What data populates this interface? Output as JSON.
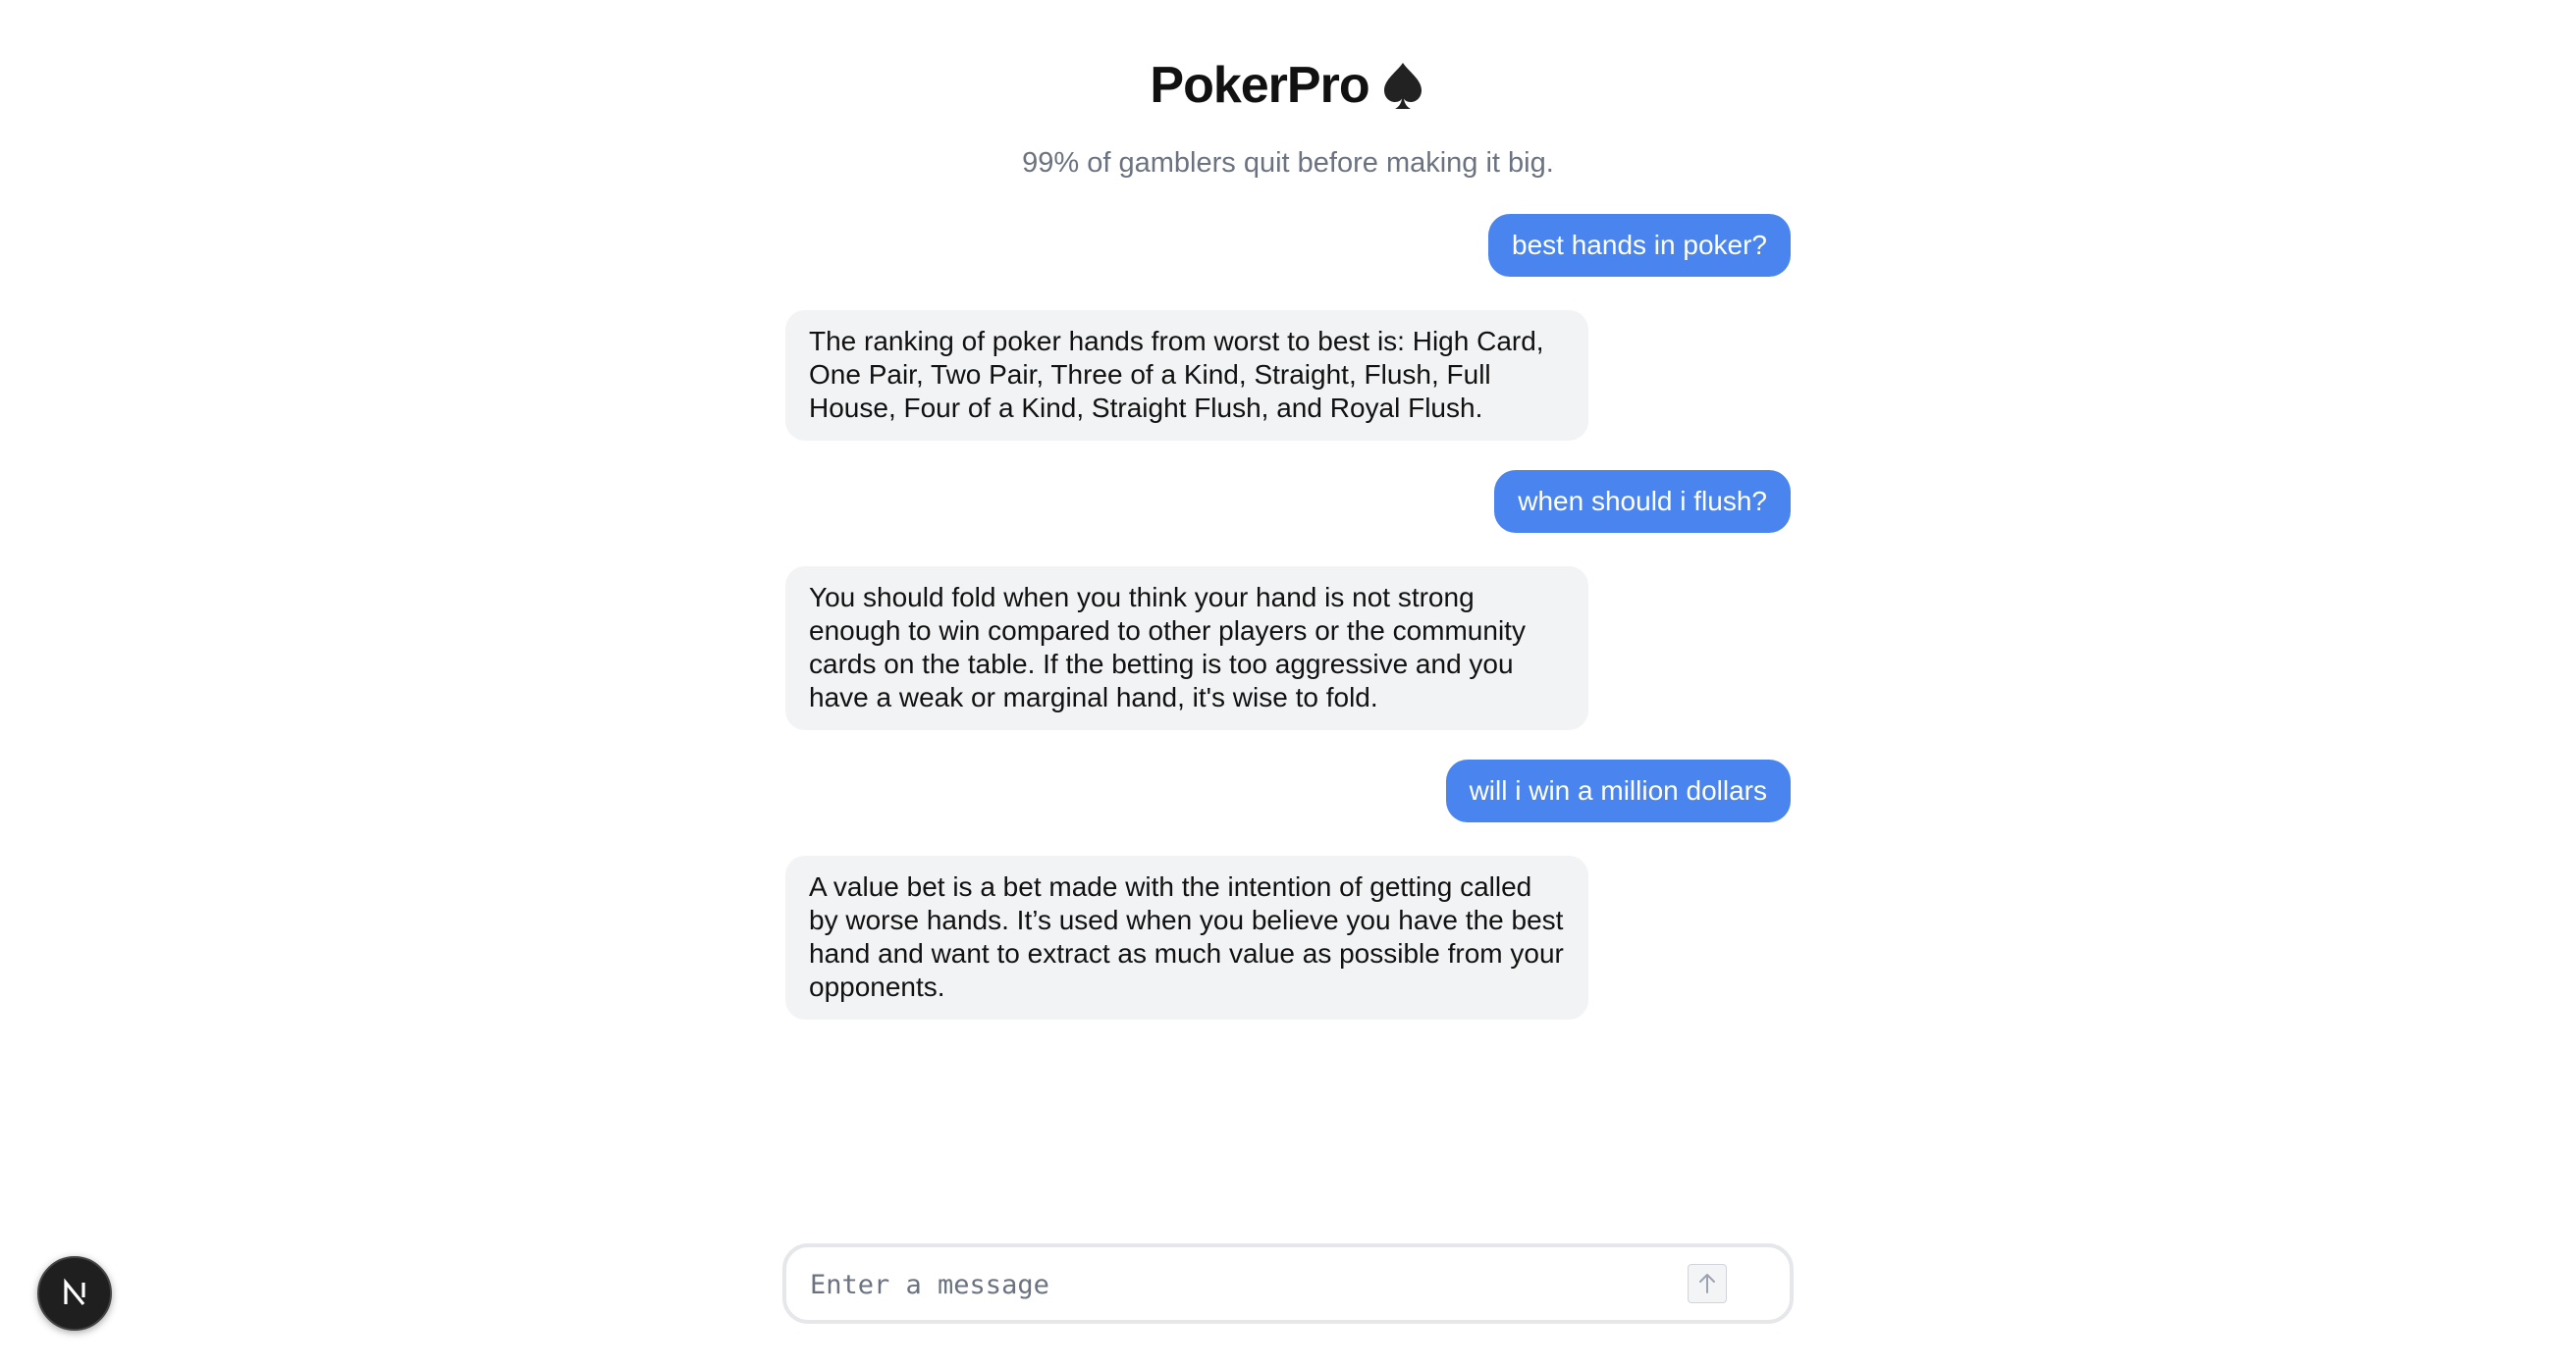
{
  "app": {
    "title": "PokerPro",
    "title_icon": "spade-icon",
    "subtitle": "99% of gamblers quit before making it big."
  },
  "messages": [
    {
      "role": "user",
      "text": "best hands in poker?"
    },
    {
      "role": "assistant",
      "text": "The ranking of poker hands from worst to best is: High Card, One Pair, Two Pair, Three of a Kind, Straight, Flush, Full House, Four of a Kind, Straight Flush, and Royal Flush."
    },
    {
      "role": "user",
      "text": "when should i flush?"
    },
    {
      "role": "assistant",
      "text": "You should fold when you think your hand is not strong enough to win compared to other players or the community cards on the table. If the betting is too aggressive and you have a weak or marginal hand, it's wise to fold."
    },
    {
      "role": "user",
      "text": "will i win a million dollars"
    },
    {
      "role": "assistant",
      "text": "A value bet is a bet made with the intention of getting called by worse hands. It’s used when you believe you have the best hand and want to extract as much value as possible from your opponents."
    }
  ],
  "composer": {
    "placeholder": "Enter a message",
    "value": "",
    "send_icon": "arrow-up-icon"
  },
  "colors": {
    "user_bubble": "#4a84ee",
    "assistant_bubble": "#f2f3f5",
    "subtitle": "#6b7280"
  },
  "dev_badge": {
    "icon": "nextjs-logo-icon"
  }
}
